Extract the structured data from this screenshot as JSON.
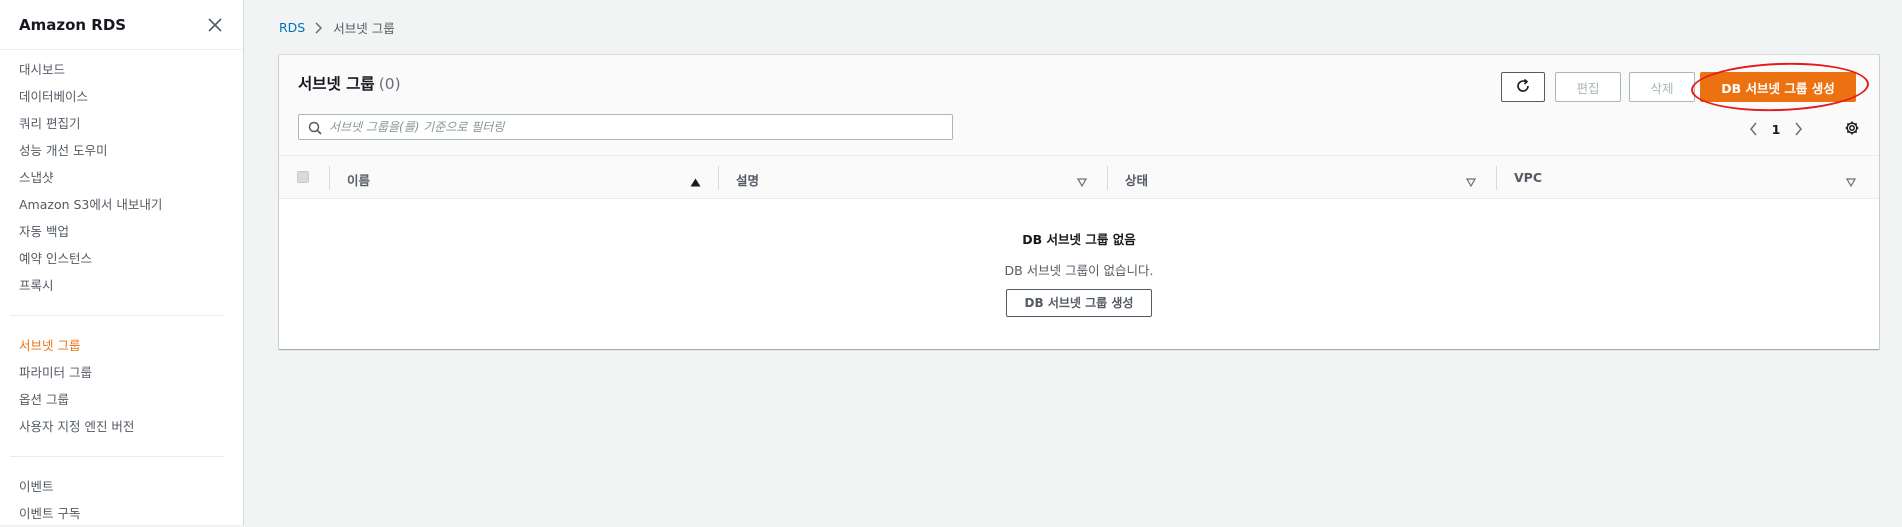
{
  "sidebar": {
    "title": "Amazon RDS",
    "items": [
      {
        "label": "대시보드"
      },
      {
        "label": "데이터베이스"
      },
      {
        "label": "쿼리 편집기"
      },
      {
        "label": "성능 개선 도우미"
      },
      {
        "label": "스냅샷"
      },
      {
        "label": "Amazon S3에서 내보내기"
      },
      {
        "label": "자동 백업"
      },
      {
        "label": "예약 인스턴스"
      },
      {
        "label": "프록시"
      }
    ],
    "group2": [
      {
        "label": "서브넷 그룹",
        "active": true
      },
      {
        "label": "파라미터 그룹"
      },
      {
        "label": "옵션 그룹"
      },
      {
        "label": "사용자 지정 엔진 버전"
      }
    ],
    "group3": [
      {
        "label": "이벤트"
      },
      {
        "label": "이벤트 구독"
      }
    ]
  },
  "breadcrumb": {
    "root": "RDS",
    "current": "서브넷 그룹"
  },
  "panel": {
    "title": "서브넷 그룹",
    "count": "(0)",
    "edit_label": "편집",
    "delete_label": "삭제",
    "create_label": "DB 서브넷 그룹 생성",
    "search_placeholder": "서브넷 그룹을(를) 기준으로 필터링",
    "page_number": "1"
  },
  "table": {
    "columns": [
      {
        "label": "이름",
        "sorted": "ascending"
      },
      {
        "label": "설명"
      },
      {
        "label": "상태"
      },
      {
        "label": "VPC"
      }
    ]
  },
  "empty_state": {
    "title": "DB 서브넷 그룹 없음",
    "description": "DB 서브넷 그룹이 없습니다.",
    "button_label": "DB 서브넷 그룹 생성"
  },
  "colors": {
    "accent": "#ec7211",
    "link": "#0073bb",
    "annotation": "#e31b1b"
  }
}
